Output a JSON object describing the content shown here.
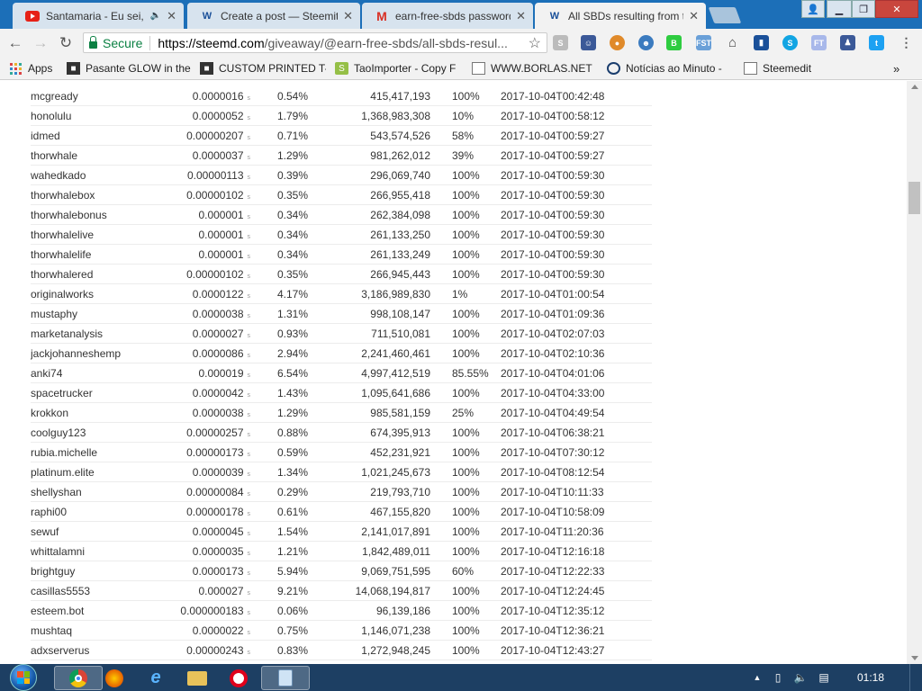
{
  "tabs": [
    {
      "title": "Santamaria - Eu sei, tu",
      "icon": "youtube-icon",
      "active": false
    },
    {
      "title": "Create a post — Steemit",
      "icon": "steemit-icon",
      "active": false
    },
    {
      "title": "earn-free-sbds password",
      "icon": "gmail-icon",
      "active": false
    },
    {
      "title": "All SBDs resulting from tl",
      "icon": "steemit-icon",
      "active": true
    }
  ],
  "toolbar": {
    "secure_label": "Secure",
    "url_host": "https://steemd.com",
    "url_path": "/giveaway/@earn-free-sbds/all-sbds-resul..."
  },
  "bookmarks": [
    {
      "label": "Apps",
      "icon": "apps-grid-icon"
    },
    {
      "label": "Pasante GLOW in the",
      "icon": "shop-icon"
    },
    {
      "label": "CUSTOM PRINTED T-",
      "icon": "shop-icon"
    },
    {
      "label": "TaoImporter - Copy F",
      "icon": "shopify-icon"
    },
    {
      "label": "WWW.BORLAS.NET",
      "icon": "page-icon"
    },
    {
      "label": "Notícias ao Minuto -",
      "icon": "clock-icon"
    },
    {
      "label": "Steemedit",
      "icon": "page-icon"
    }
  ],
  "table": {
    "unit": "s",
    "rows": [
      {
        "user": "mcgready",
        "sbd": "0.0000016",
        "pct": "0.54%",
        "vests": "415,417,193",
        "weight": "100%",
        "time": "2017-10-04T00:42:48"
      },
      {
        "user": "honolulu",
        "sbd": "0.0000052",
        "pct": "1.79%",
        "vests": "1,368,983,308",
        "weight": "10%",
        "time": "2017-10-04T00:58:12"
      },
      {
        "user": "idmed",
        "sbd": "0.00000207",
        "pct": "0.71%",
        "vests": "543,574,526",
        "weight": "58%",
        "time": "2017-10-04T00:59:27"
      },
      {
        "user": "thorwhale",
        "sbd": "0.0000037",
        "pct": "1.29%",
        "vests": "981,262,012",
        "weight": "39%",
        "time": "2017-10-04T00:59:27"
      },
      {
        "user": "wahedkado",
        "sbd": "0.00000113",
        "pct": "0.39%",
        "vests": "296,069,740",
        "weight": "100%",
        "time": "2017-10-04T00:59:30"
      },
      {
        "user": "thorwhalebox",
        "sbd": "0.00000102",
        "pct": "0.35%",
        "vests": "266,955,418",
        "weight": "100%",
        "time": "2017-10-04T00:59:30"
      },
      {
        "user": "thorwhalebonus",
        "sbd": "0.000001",
        "pct": "0.34%",
        "vests": "262,384,098",
        "weight": "100%",
        "time": "2017-10-04T00:59:30"
      },
      {
        "user": "thorwhalelive",
        "sbd": "0.000001",
        "pct": "0.34%",
        "vests": "261,133,250",
        "weight": "100%",
        "time": "2017-10-04T00:59:30"
      },
      {
        "user": "thorwhalelife",
        "sbd": "0.000001",
        "pct": "0.34%",
        "vests": "261,133,249",
        "weight": "100%",
        "time": "2017-10-04T00:59:30"
      },
      {
        "user": "thorwhalered",
        "sbd": "0.00000102",
        "pct": "0.35%",
        "vests": "266,945,443",
        "weight": "100%",
        "time": "2017-10-04T00:59:30"
      },
      {
        "user": "originalworks",
        "sbd": "0.0000122",
        "pct": "4.17%",
        "vests": "3,186,989,830",
        "weight": "1%",
        "time": "2017-10-04T01:00:54"
      },
      {
        "user": "mustaphy",
        "sbd": "0.0000038",
        "pct": "1.31%",
        "vests": "998,108,147",
        "weight": "100%",
        "time": "2017-10-04T01:09:36"
      },
      {
        "user": "marketanalysis",
        "sbd": "0.0000027",
        "pct": "0.93%",
        "vests": "711,510,081",
        "weight": "100%",
        "time": "2017-10-04T02:07:03"
      },
      {
        "user": "jackjohanneshemp",
        "sbd": "0.0000086",
        "pct": "2.94%",
        "vests": "2,241,460,461",
        "weight": "100%",
        "time": "2017-10-04T02:10:36"
      },
      {
        "user": "anki74",
        "sbd": "0.000019",
        "pct": "6.54%",
        "vests": "4,997,412,519",
        "weight": "85.55%",
        "time": "2017-10-04T04:01:06"
      },
      {
        "user": "spacetrucker",
        "sbd": "0.0000042",
        "pct": "1.43%",
        "vests": "1,095,641,686",
        "weight": "100%",
        "time": "2017-10-04T04:33:00"
      },
      {
        "user": "krokkon",
        "sbd": "0.0000038",
        "pct": "1.29%",
        "vests": "985,581,159",
        "weight": "25%",
        "time": "2017-10-04T04:49:54"
      },
      {
        "user": "coolguy123",
        "sbd": "0.00000257",
        "pct": "0.88%",
        "vests": "674,395,913",
        "weight": "100%",
        "time": "2017-10-04T06:38:21"
      },
      {
        "user": "rubia.michelle",
        "sbd": "0.00000173",
        "pct": "0.59%",
        "vests": "452,231,921",
        "weight": "100%",
        "time": "2017-10-04T07:30:12"
      },
      {
        "user": "platinum.elite",
        "sbd": "0.0000039",
        "pct": "1.34%",
        "vests": "1,021,245,673",
        "weight": "100%",
        "time": "2017-10-04T08:12:54"
      },
      {
        "user": "shellyshan",
        "sbd": "0.00000084",
        "pct": "0.29%",
        "vests": "219,793,710",
        "weight": "100%",
        "time": "2017-10-04T10:11:33"
      },
      {
        "user": "raphi00",
        "sbd": "0.00000178",
        "pct": "0.61%",
        "vests": "467,155,820",
        "weight": "100%",
        "time": "2017-10-04T10:58:09"
      },
      {
        "user": "sewuf",
        "sbd": "0.0000045",
        "pct": "1.54%",
        "vests": "2,141,017,891",
        "weight": "100%",
        "time": "2017-10-04T11:20:36"
      },
      {
        "user": "whittalamni",
        "sbd": "0.0000035",
        "pct": "1.21%",
        "vests": "1,842,489,011",
        "weight": "100%",
        "time": "2017-10-04T12:16:18"
      },
      {
        "user": "brightguy",
        "sbd": "0.0000173",
        "pct": "5.94%",
        "vests": "9,069,751,595",
        "weight": "60%",
        "time": "2017-10-04T12:22:33"
      },
      {
        "user": "casillas5553",
        "sbd": "0.000027",
        "pct": "9.21%",
        "vests": "14,068,194,817",
        "weight": "100%",
        "time": "2017-10-04T12:24:45"
      },
      {
        "user": "esteem.bot",
        "sbd": "0.000000183",
        "pct": "0.06%",
        "vests": "96,139,186",
        "weight": "100%",
        "time": "2017-10-04T12:35:12"
      },
      {
        "user": "mushtaq",
        "sbd": "0.0000022",
        "pct": "0.75%",
        "vests": "1,146,071,238",
        "weight": "100%",
        "time": "2017-10-04T12:36:21"
      },
      {
        "user": "adxserverus",
        "sbd": "0.00000243",
        "pct": "0.83%",
        "vests": "1,272,948,245",
        "weight": "100%",
        "time": "2017-10-04T12:43:27"
      }
    ]
  },
  "taskbar": {
    "clock": "01:18"
  },
  "colors": {
    "tabbar": "#1c6fb8",
    "secure": "#0b8043",
    "taskbar": "#1d3f63"
  }
}
